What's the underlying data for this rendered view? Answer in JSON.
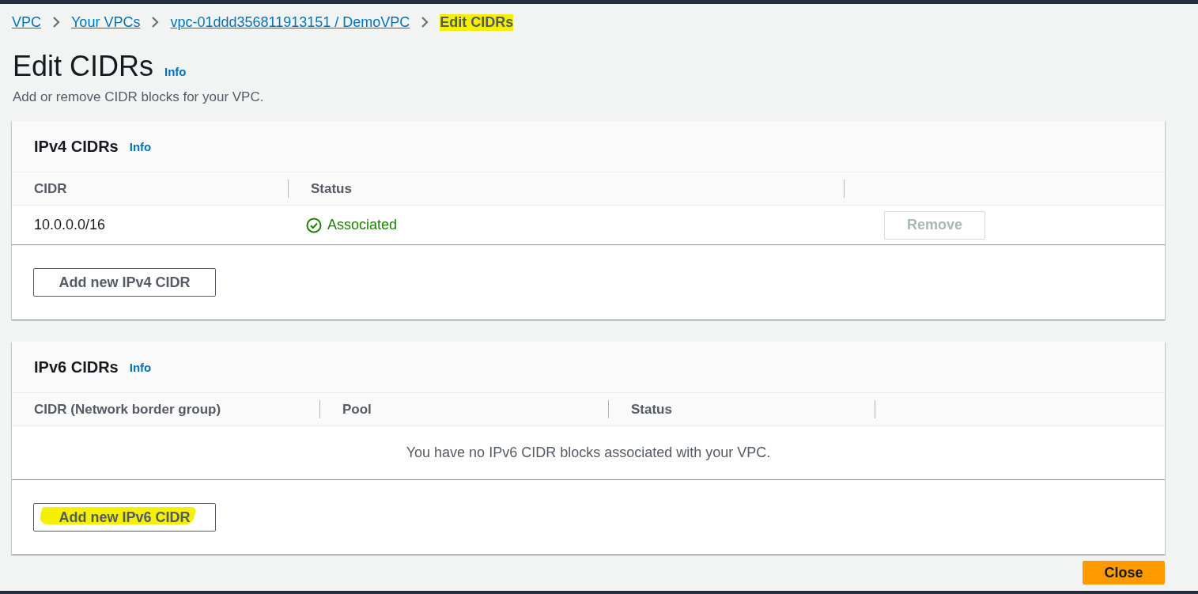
{
  "breadcrumb": [
    {
      "label": "VPC",
      "kind": "link",
      "highlighted": false
    },
    {
      "label": "Your VPCs",
      "kind": "link",
      "highlighted": false
    },
    {
      "label": "vpc-01ddd356811913151 / DemoVPC",
      "kind": "link",
      "highlighted": false
    },
    {
      "label": "Edit CIDRs",
      "kind": "current",
      "highlighted": true
    }
  ],
  "page": {
    "title": "Edit CIDRs",
    "info": "Info",
    "description": "Add or remove CIDR blocks for your VPC."
  },
  "panels": [
    {
      "title": "IPv4 CIDRs",
      "info": "Info",
      "columns": [
        "CIDR",
        "Status"
      ],
      "rows": [
        {
          "cidr": "10.0.0.0/16",
          "status": "Associated",
          "status_ok": true,
          "action": {
            "label": "Remove",
            "disabled": true
          }
        }
      ],
      "add_button": {
        "label": "Add new IPv4 CIDR",
        "highlighted": false
      }
    },
    {
      "title": "IPv6 CIDRs",
      "info": "Info",
      "columns": [
        "CIDR (Network border group)",
        "Pool",
        "Status"
      ],
      "empty_message": "You have no IPv6 CIDR blocks associated with your VPC.",
      "add_button": {
        "label": "Add new IPv6 CIDR",
        "highlighted": true
      }
    }
  ],
  "footer": {
    "close_button": "Close"
  }
}
